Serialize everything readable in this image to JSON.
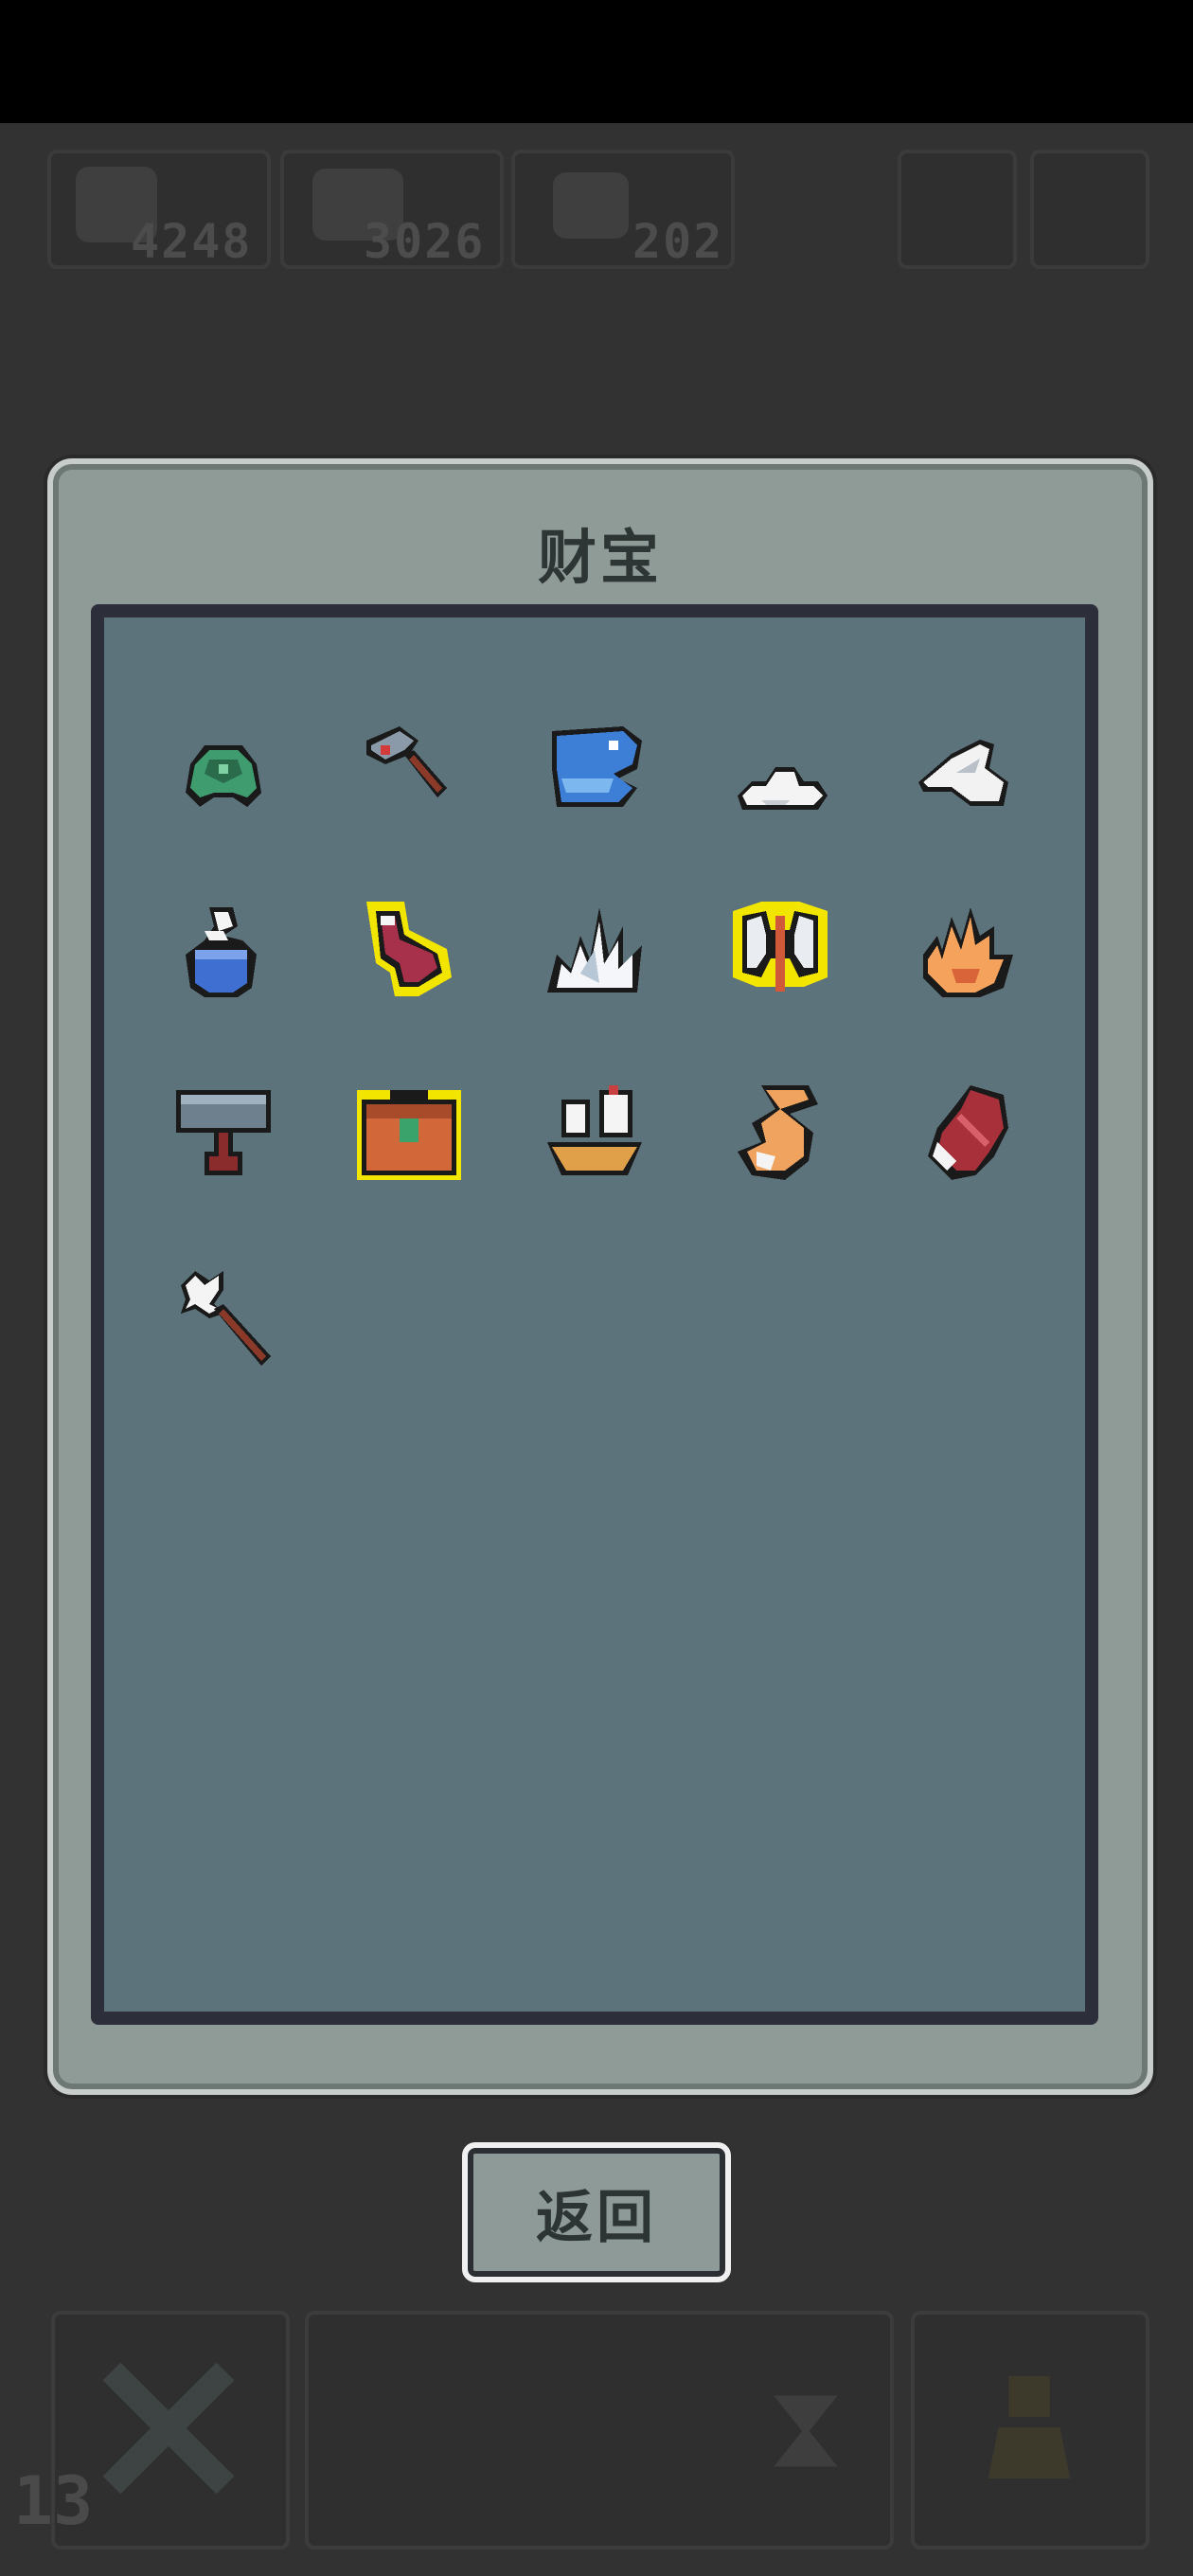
{
  "panel": {
    "title": "财宝"
  },
  "hud": {
    "resources": [
      {
        "icon": "ore-icon",
        "value": "4248"
      },
      {
        "icon": "fish-icon",
        "value": "3026"
      },
      {
        "icon": "squirrel-icon",
        "value": "202"
      }
    ]
  },
  "treasures": [
    {
      "name": "green-turtle-shell-icon",
      "highlighted": false
    },
    {
      "name": "ruby-hammer-icon",
      "highlighted": false
    },
    {
      "name": "blue-shell-icon",
      "highlighted": false
    },
    {
      "name": "cloud-icon",
      "highlighted": false
    },
    {
      "name": "winged-sandal-icon",
      "highlighted": false
    },
    {
      "name": "genie-pot-icon",
      "highlighted": false
    },
    {
      "name": "red-boot-icon",
      "highlighted": true
    },
    {
      "name": "ice-crystal-icon",
      "highlighted": false
    },
    {
      "name": "battle-axe-icon",
      "highlighted": true
    },
    {
      "name": "flame-hand-icon",
      "highlighted": false
    },
    {
      "name": "war-hammer-icon",
      "highlighted": false
    },
    {
      "name": "treasure-chest-icon",
      "highlighted": true
    },
    {
      "name": "sailing-ship-icon",
      "highlighted": false
    },
    {
      "name": "fox-tail-icon",
      "highlighted": false
    },
    {
      "name": "red-feather-icon",
      "highlighted": false
    },
    {
      "name": "magic-wand-icon",
      "highlighted": false
    }
  ],
  "buttons": {
    "back_label": "返回"
  },
  "bottom": {
    "counter": "13"
  },
  "colors": {
    "highlight": "#f2e600",
    "panel": "#8f9b97",
    "inner": "#5d737b"
  }
}
